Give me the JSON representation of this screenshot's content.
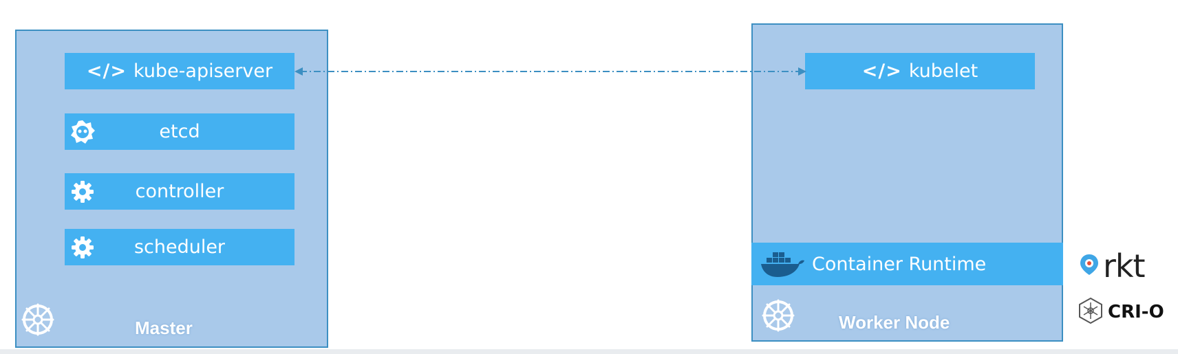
{
  "master": {
    "label": "Master",
    "components": [
      {
        "tag": "</>",
        "label": "kube-apiserver",
        "icon": "code-icon"
      },
      {
        "label": "etcd",
        "icon": "etcd-icon"
      },
      {
        "label": "controller",
        "icon": "gear-icon"
      },
      {
        "label": "scheduler",
        "icon": "gear-icon"
      }
    ]
  },
  "worker": {
    "label": "Worker Node",
    "kubelet": {
      "tag": "</>",
      "label": "kubelet",
      "icon": "code-icon"
    },
    "runtime": {
      "label": "Container Runtime",
      "icon": "docker-whale-icon"
    }
  },
  "runtimes": [
    {
      "label": "rkt",
      "icon": "rkt-icon"
    },
    {
      "label": "CRI-O",
      "icon": "crio-icon"
    }
  ],
  "colors": {
    "node_fill": "#a9c9ea",
    "node_border": "#3c8fc2",
    "component_fill": "#44b1f1",
    "connector": "#3c8fc2"
  }
}
